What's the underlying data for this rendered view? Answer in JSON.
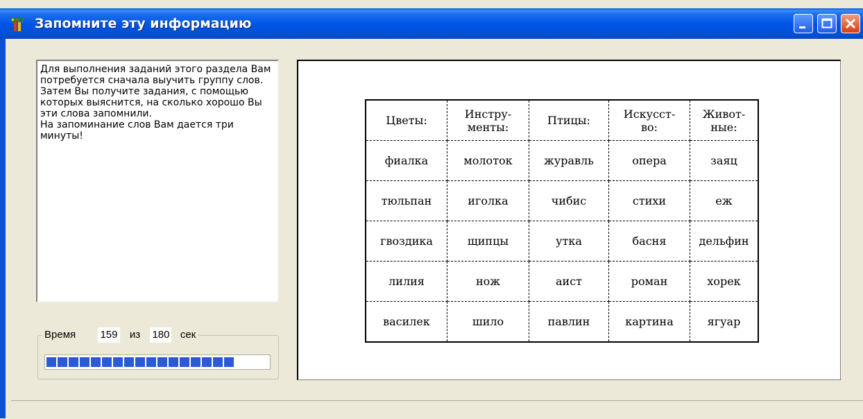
{
  "window": {
    "title": "Запомните эту информацию",
    "icon": "app-icon",
    "buttons": [
      "minimize-icon",
      "maximize-icon",
      "close-icon"
    ]
  },
  "instructions": {
    "lines": [
      "Для выполнения заданий этого раздела Вам потребуется сначала выучить группу слов.",
      "Затем Вы получите задания, с помощью которых выяснится, на сколько хорошо Вы эти слова запомнили.",
      "На запоминание слов Вам дается три минуты!"
    ]
  },
  "timer": {
    "label": "Время",
    "current": "159",
    "separator": "из",
    "total": "180",
    "unit": "сек",
    "progress_fraction": 0.883,
    "progress_color": "#2a5ad6"
  },
  "table": {
    "headers": [
      "Цветы:",
      "Инстру-\nменты:",
      "Птицы:",
      "Искусст-\nво:",
      "Живот-\nные:"
    ],
    "rows": [
      [
        "фиалка",
        "молоток",
        "журавль",
        "опера",
        "заяц"
      ],
      [
        "тюльпан",
        "иголка",
        "чибис",
        "стихи",
        "еж"
      ],
      [
        "гвоздика",
        "щипцы",
        "утка",
        "басня",
        "дельфин"
      ],
      [
        "лилия",
        "нож",
        "аист",
        "роман",
        "хорек"
      ],
      [
        "василек",
        "шило",
        "павлин",
        "картина",
        "ягуар"
      ]
    ]
  }
}
